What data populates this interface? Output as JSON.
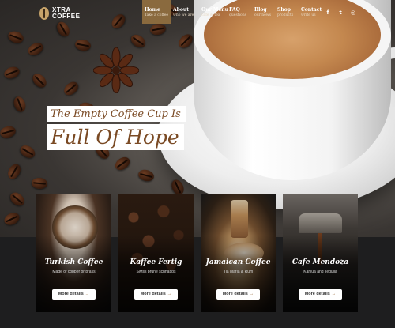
{
  "brand": {
    "line1": "XTRA",
    "line2": "COFFEE"
  },
  "menu": [
    {
      "title": "Home",
      "subtitle": "Take a coffee",
      "active": true
    },
    {
      "title": "About",
      "subtitle": "who we are",
      "active": false
    },
    {
      "title": "Our Menu",
      "subtitle": "cafe & tea",
      "active": false
    },
    {
      "title": "FAQ",
      "subtitle": "questions",
      "active": false
    },
    {
      "title": "Blog",
      "subtitle": "our news",
      "active": false
    },
    {
      "title": "Shop",
      "subtitle": "products",
      "active": false
    },
    {
      "title": "Contact",
      "subtitle": "write us",
      "active": false
    }
  ],
  "social": [
    {
      "icon": "facebook-icon",
      "glyph": "f"
    },
    {
      "icon": "twitter-icon",
      "glyph": "t"
    },
    {
      "icon": "instagram-icon",
      "glyph": "◎"
    }
  ],
  "hero": {
    "tagline": "The Empty Coffee Cup Is",
    "headline": "Full Of Hope"
  },
  "cards": [
    {
      "title": "Turkish Coffee",
      "subtitle": "Made of copper or brass",
      "button": "More details",
      "arrow": "→"
    },
    {
      "title": "Kaffee Fertig",
      "subtitle": "Swiss prune schnapps",
      "button": "More details",
      "arrow": "→"
    },
    {
      "title": "Jamaican Coffee",
      "subtitle": "Tia Maria & Rum",
      "button": "More details",
      "arrow": "→"
    },
    {
      "title": "Cafe Mendoza",
      "subtitle": "Kahlúa and Tequila",
      "button": "More details",
      "arrow": "→"
    }
  ],
  "colors": {
    "accent": "#8a6a3e",
    "headline": "#7a4a24",
    "dark": "#1e1e1f"
  }
}
